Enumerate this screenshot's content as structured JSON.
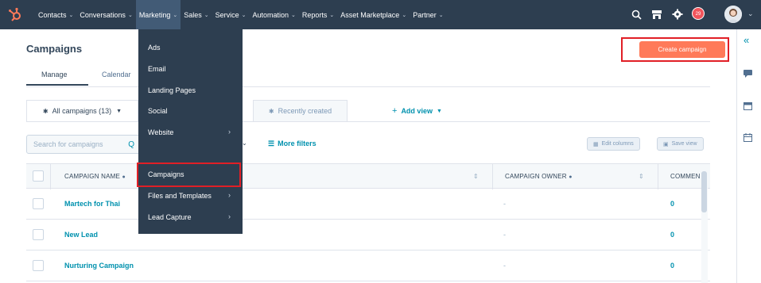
{
  "nav": {
    "items": [
      {
        "label": "Contacts"
      },
      {
        "label": "Conversations"
      },
      {
        "label": "Marketing"
      },
      {
        "label": "Sales"
      },
      {
        "label": "Service"
      },
      {
        "label": "Automation"
      },
      {
        "label": "Reports"
      },
      {
        "label": "Asset Marketplace"
      },
      {
        "label": "Partner"
      }
    ],
    "notification_count": "29"
  },
  "marketing_menu": {
    "items": [
      {
        "label": "Ads"
      },
      {
        "label": "Email"
      },
      {
        "label": "Landing Pages"
      },
      {
        "label": "Social"
      },
      {
        "label": "Website"
      },
      {
        "label": "Campaigns"
      },
      {
        "label": "Files and Templates"
      },
      {
        "label": "Lead Capture"
      }
    ],
    "selected": "Campaigns"
  },
  "page": {
    "title": "Campaigns",
    "create_button": "Create campaign",
    "tabs": [
      {
        "label": "Manage"
      },
      {
        "label": "Calendar"
      }
    ]
  },
  "views": {
    "tabs": [
      {
        "label": "All campaigns (13)"
      },
      {
        "label": "Recently created"
      }
    ],
    "add_view": "Add view"
  },
  "toolbar": {
    "search_placeholder": "Search for campaigns",
    "more_filters": "More filters",
    "edit_columns": "Edit columns",
    "save_view": "Save view"
  },
  "table": {
    "columns": [
      "CAMPAIGN NAME",
      "CAMPAIGN OWNER",
      "COMMEN"
    ],
    "rows": [
      {
        "name": "Martech for Thai",
        "owner": "-",
        "comments": "0"
      },
      {
        "name": "New Lead",
        "owner": "-",
        "comments": "0"
      },
      {
        "name": "Nurturing Campaign",
        "owner": "-",
        "comments": "0"
      }
    ]
  },
  "colors": {
    "nav_bg": "#2d3e50",
    "accent": "#ff7a59",
    "link": "#0091ae",
    "highlight": "#e11f26"
  }
}
